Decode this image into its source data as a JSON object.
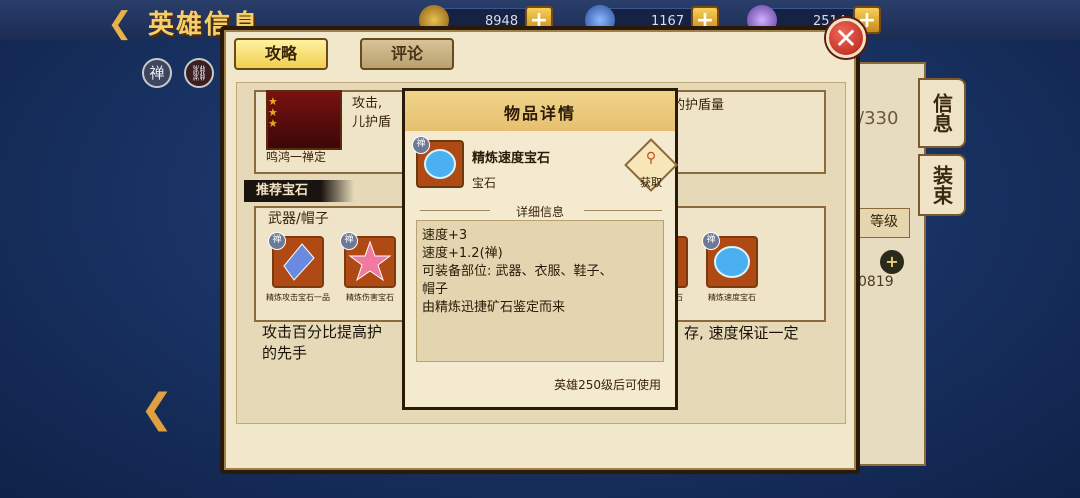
{
  "header": {
    "title": "英雄信息",
    "resources": [
      {
        "name": "coin",
        "value": "8948万"
      },
      {
        "name": "gem",
        "value": "1167万"
      },
      {
        "name": "crystal",
        "value": "2514"
      }
    ],
    "plus": "+"
  },
  "background": {
    "value_text": "/330",
    "side_tabs": [
      "信息",
      "装束"
    ],
    "level_label": "等级",
    "num_fragment": "0819",
    "zen_icon": "禅"
  },
  "dialog": {
    "tabs": [
      {
        "label": "攻略",
        "active": true
      },
      {
        "label": "评论",
        "active": false
      }
    ],
    "close": "✕",
    "character": {
      "name": "鸣鸿一禅定",
      "skill_text_1": "攻击,",
      "skill_text_2": "儿护盾",
      "shield_text": "的护盾量"
    },
    "section_title": "推荐宝石",
    "gem_group_title": "武器/帽子",
    "gems": [
      {
        "label": "精炼攻击宝石一品",
        "badge": "禅"
      },
      {
        "label": "精炼伤害宝石",
        "badge": "禅"
      },
      {
        "label": "石",
        "badge": "禅"
      },
      {
        "label": "精炼速度宝石",
        "badge": "禅"
      }
    ],
    "description_left_1": "攻击百分比提高护",
    "description_left_2": "的先手",
    "description_right": "存, 速度保证一定"
  },
  "popup": {
    "title": "物品详情",
    "item_name": "精炼速度宝石",
    "item_type": "宝石",
    "item_badge": "禅",
    "get_label": "获取",
    "detail_title": "详细信息",
    "attributes": [
      "速度+3",
      "速度+1.2(禅)",
      "可装备部位: 武器、衣服、鞋子、",
      "帽子",
      "由精炼迅捷矿石鉴定而来"
    ],
    "requirement": "英雄250级后可使用"
  },
  "colors": {
    "accent": "#f0cf50",
    "close": "#b41e16",
    "panel": "#f1e7cb"
  }
}
